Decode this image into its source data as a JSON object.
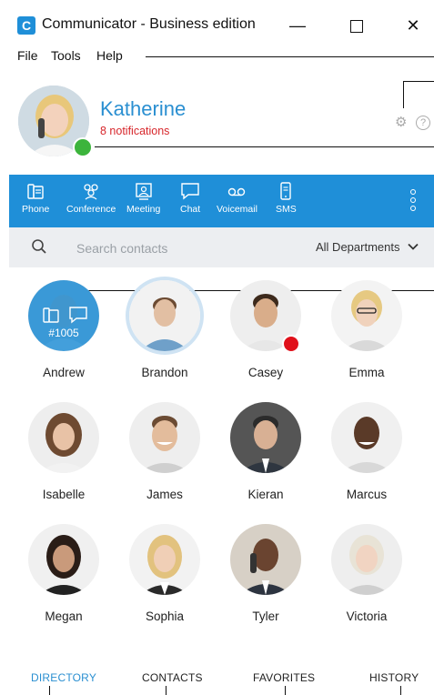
{
  "window": {
    "title": "Communicator - Business edition",
    "logo_letter": "C",
    "minimize": "—",
    "close": "✕"
  },
  "menu": [
    "File",
    "Tools",
    "Help"
  ],
  "user": {
    "name": "Katherine",
    "notifications": "8 notifications",
    "status": "online",
    "help_glyph": "?"
  },
  "toolbar": [
    {
      "label": "Phone",
      "icon": "phone-icon"
    },
    {
      "label": "Conference",
      "icon": "conference-icon"
    },
    {
      "label": "Meeting",
      "icon": "meeting-icon"
    },
    {
      "label": "Chat",
      "icon": "chat-icon"
    },
    {
      "label": "Voicemail",
      "icon": "voicemail-icon"
    },
    {
      "label": "SMS",
      "icon": "sms-icon"
    }
  ],
  "search": {
    "placeholder": "Search contacts",
    "department": "All Departments"
  },
  "contacts": [
    {
      "name": "Andrew",
      "extension": "#1005"
    },
    {
      "name": "Brandon"
    },
    {
      "name": "Casey",
      "status": "busy"
    },
    {
      "name": "Emma"
    },
    {
      "name": "Isabelle"
    },
    {
      "name": "James"
    },
    {
      "name": "Kieran"
    },
    {
      "name": "Marcus"
    },
    {
      "name": "Megan"
    },
    {
      "name": "Sophia"
    },
    {
      "name": "Tyler"
    },
    {
      "name": "Victoria"
    }
  ],
  "tabs": [
    {
      "label": "DIRECTORY",
      "active": true
    },
    {
      "label": "CONTACTS"
    },
    {
      "label": "FAVORITES"
    },
    {
      "label": "HISTORY"
    }
  ],
  "colors": {
    "accent": "#1f8fd8",
    "online": "#3cb43c",
    "busy": "#e0101a",
    "notification": "#d7262b"
  }
}
